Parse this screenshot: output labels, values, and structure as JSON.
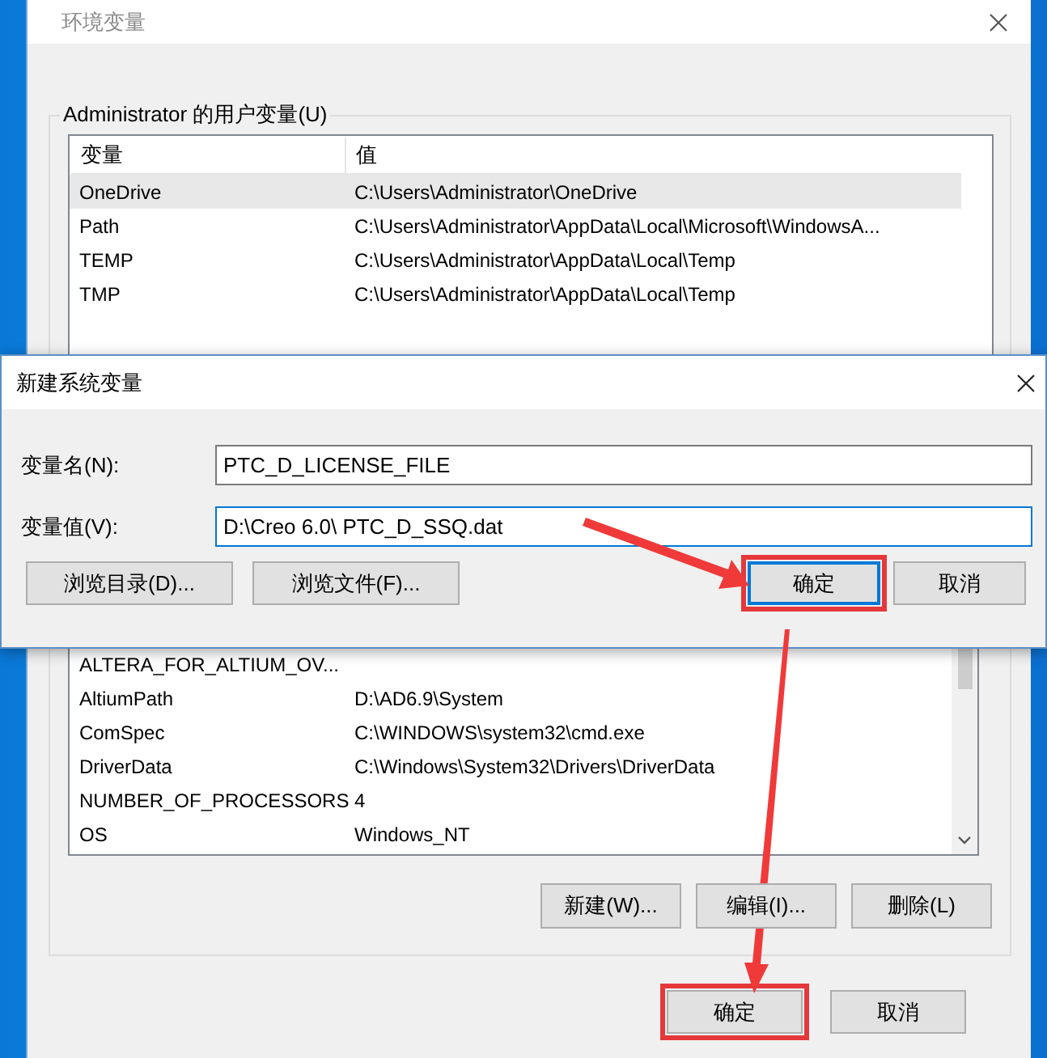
{
  "window": {
    "title": "环境变量",
    "active": false
  },
  "user_variables": {
    "title": "Administrator 的用户变量(U)",
    "columns": [
      "变量",
      "值"
    ],
    "rows": [
      {
        "name": "OneDrive",
        "value": "C:\\Users\\Administrator\\OneDrive",
        "selected": true
      },
      {
        "name": "Path",
        "value": "C:\\Users\\Administrator\\AppData\\Local\\Microsoft\\WindowsA...",
        "selected": false
      },
      {
        "name": "TEMP",
        "value": "C:\\Users\\Administrator\\AppData\\Local\\Temp",
        "selected": false
      },
      {
        "name": "TMP",
        "value": "C:\\Users\\Administrator\\AppData\\Local\\Temp",
        "selected": false
      }
    ]
  },
  "system_variables": {
    "rows": [
      {
        "name": "ALTERA_FOR_ALTIUM_OV...",
        "selected": false
      },
      {
        "name": "AltiumPath",
        "value": "D:\\AD6.9\\System",
        "selected": false
      },
      {
        "name": "ComSpec",
        "value": "C:\\WINDOWS\\system32\\cmd.exe",
        "selected": false
      },
      {
        "name": "DriverData",
        "value": "C:\\Windows\\System32\\Drivers\\DriverData",
        "selected": false
      },
      {
        "name": "NUMBER_OF_PROCESSORS",
        "value": "4",
        "selected": false
      },
      {
        "name": "OS",
        "value": "Windows_NT",
        "selected": false
      }
    ],
    "buttons": [
      {
        "label": "新建(W)..."
      },
      {
        "label": "编辑(I)..."
      },
      {
        "label": "删除(L)"
      }
    ]
  },
  "buttons": [
    {
      "label": "确定",
      "highlighted": true
    },
    {
      "label": "取消",
      "highlighted": false
    }
  ],
  "dialog": {
    "title": "新建系统变量",
    "active": true,
    "fields": [
      {
        "label": "变量名(N):",
        "value": "PTC_D_LICENSE_FILE",
        "focused": false
      },
      {
        "label": "变量值(V):",
        "value": "D:\\Creo 6.0\\ PTC_D_SSQ.dat",
        "focused": true
      }
    ],
    "browse_buttons": [
      {
        "label": "浏览目录(D)..."
      },
      {
        "label": "浏览文件(F)..."
      }
    ],
    "buttons": [
      {
        "label": "确定",
        "default": true,
        "highlighted": true
      },
      {
        "label": "取消",
        "default": false,
        "highlighted": false
      }
    ]
  }
}
